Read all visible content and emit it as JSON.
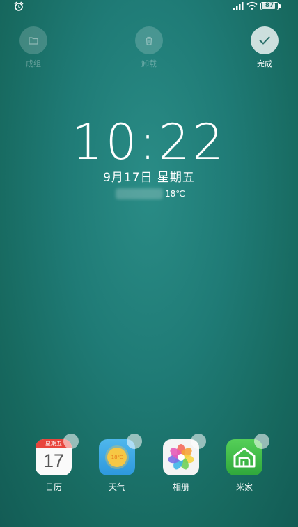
{
  "status_bar": {
    "battery_level": "87",
    "battery_fraction": 0.87
  },
  "edit_actions": {
    "group_label": "成组",
    "uninstall_label": "卸载",
    "done_label": "完成"
  },
  "clock_widget": {
    "time": "10:22",
    "date": "9月17日 星期五",
    "temperature": "18℃"
  },
  "dock": {
    "apps": [
      {
        "label": "日历",
        "icon": "calendar-icon",
        "weekday": "星期五",
        "day": "17"
      },
      {
        "label": "天气",
        "icon": "weather-icon",
        "temp": "18℃"
      },
      {
        "label": "相册",
        "icon": "gallery-icon"
      },
      {
        "label": "米家",
        "icon": "mi-home-icon"
      }
    ]
  },
  "colors": {
    "wallpaper": "#1f7b76",
    "calendar_red": "#e8453c",
    "weather_blue": "#3aa6e4",
    "mi_green": "#3fbc47"
  }
}
